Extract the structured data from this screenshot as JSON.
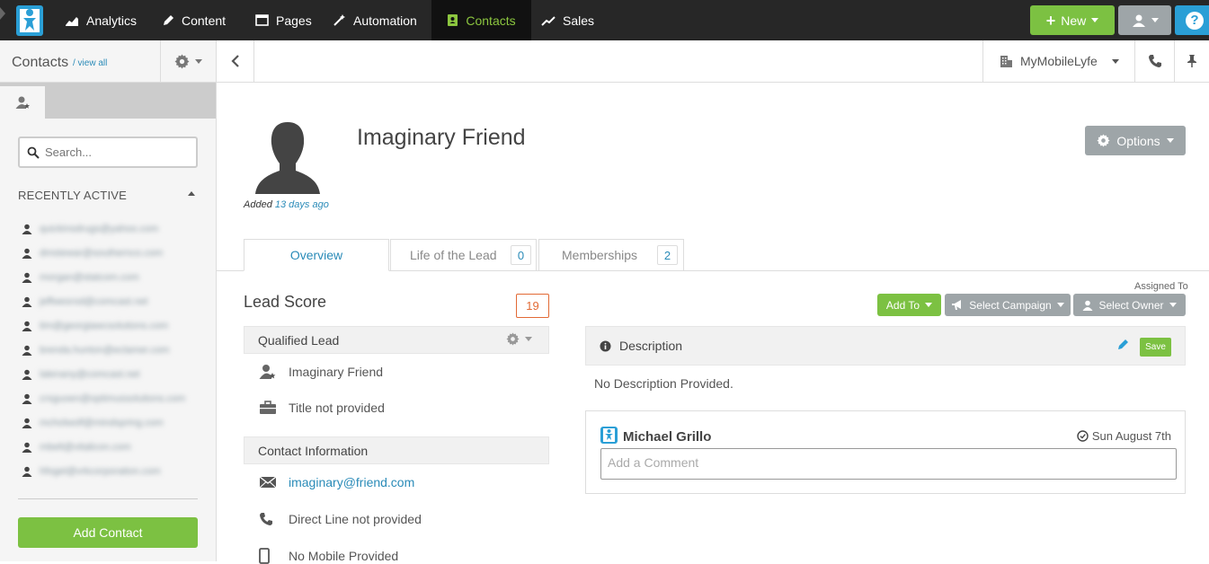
{
  "nav": {
    "items": [
      {
        "label": "Analytics",
        "icon": "chart-line-icon"
      },
      {
        "label": "Content",
        "icon": "pencil-icon"
      },
      {
        "label": "Pages",
        "icon": "window-icon"
      },
      {
        "label": "Automation",
        "icon": "magic-wand-icon"
      },
      {
        "label": "Contacts",
        "icon": "address-book-icon",
        "active": true
      },
      {
        "label": "Sales",
        "icon": "trend-up-icon"
      }
    ],
    "new_label": "New",
    "help_glyph": "?"
  },
  "sidebar": {
    "title": "Contacts",
    "view_all": "/ view all",
    "search_placeholder": "Search...",
    "recently_active_label": "RECENTLY ACTIVE",
    "recent_contacts": [
      "quickinsdrugs@yahoo.com",
      "dmstewar@southernco.com",
      "morgan@statcom.com",
      "jeffwesrod@comcast.net",
      "tim@georgiawcsolutions.com",
      "brenda.hunton@eclamer.com",
      "lalenany@comcast.net",
      "crsguoen@optimussolutions.com",
      "mcholwolf@mindspring.com",
      "mbelt@vitalicon.com",
      "hfogel@vrkcorporation.com"
    ],
    "add_contact": "Add Contact"
  },
  "toolbar": {
    "company": "MyMobileLyfe"
  },
  "contact": {
    "name": "Imaginary Friend",
    "added_prefix": "Added",
    "added_when": "13 days ago",
    "options_label": "Options"
  },
  "tabs": [
    {
      "label": "Overview",
      "active": true
    },
    {
      "label": "Life of the Lead",
      "count": "0"
    },
    {
      "label": "Memberships",
      "count": "2"
    }
  ],
  "lead": {
    "title": "Lead Score",
    "score": "19",
    "status_section": "Qualified Lead",
    "name": "Imaginary Friend",
    "title_text": "Title not provided",
    "contact_section": "Contact Information",
    "email": "imaginary@friend.com",
    "direct_line": "Direct Line not provided",
    "mobile": "No Mobile Provided"
  },
  "right": {
    "assigned_to": "Assigned To",
    "add_to": "Add To",
    "select_campaign": "Select Campaign",
    "select_owner": "Select Owner",
    "description_title": "Description",
    "save": "Save",
    "no_description": "No Description Provided.",
    "comment_author": "Michael Grillo",
    "comment_date": "Sun August 7th",
    "comment_placeholder": "Add a Comment"
  },
  "colors": {
    "accent_green": "#7cc142",
    "nav_bg": "#272727",
    "link_blue": "#2a8bb8",
    "gray_button": "#9ea5a8",
    "score_orange": "#e26a35"
  }
}
